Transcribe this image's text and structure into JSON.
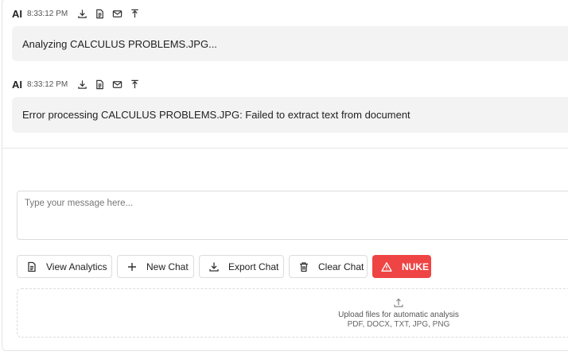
{
  "messages": [
    {
      "sender": "AI",
      "time": "8:33:12 PM",
      "text": "Analyzing CALCULUS PROBLEMS.JPG..."
    },
    {
      "sender": "AI",
      "time": "8:33:12 PM",
      "text": "Error processing CALCULUS PROBLEMS.JPG: Failed to extract text from document"
    }
  ],
  "message_actions": [
    "download-icon",
    "document-icon",
    "mail-icon",
    "upload-icon"
  ],
  "composer": {
    "placeholder": "Type your message here..."
  },
  "toolbar": {
    "view_analytics": "View Analytics",
    "new_chat": "New Chat",
    "export_chat": "Export Chat",
    "clear_chat": "Clear Chat",
    "nuke": "NUKE"
  },
  "upload": {
    "title": "Upload files for automatic analysis",
    "formats": "PDF, DOCX, TXT, JPG, PNG"
  },
  "colors": {
    "nuke_bg": "#ef4444",
    "bubble_bg": "#f3f3f3"
  }
}
